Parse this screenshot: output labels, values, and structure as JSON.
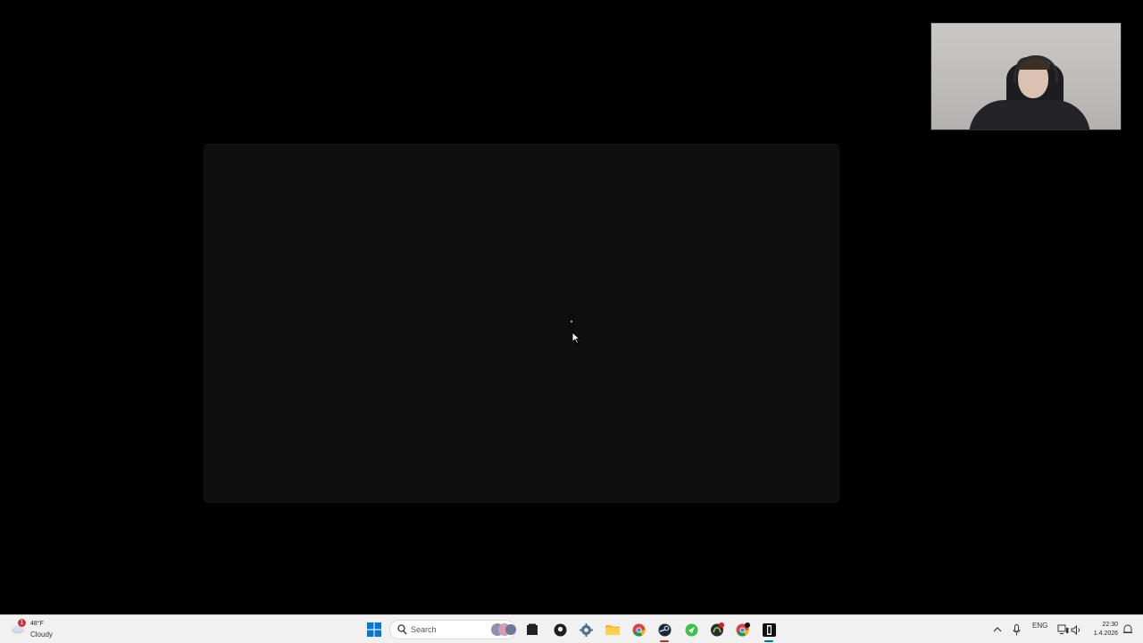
{
  "weather": {
    "badge": "1",
    "temp": "48°F",
    "condition": "Cloudy"
  },
  "taskbar": {
    "search_label": "Search",
    "language": "ENG"
  },
  "clock": {
    "time": "22:30",
    "date": "1.4.2026"
  },
  "colors": {
    "accent": "#0067c0",
    "taskbar_bg": "#f1f1f1",
    "app_window_bg": "#0f0f0f"
  },
  "icons": [
    "windows-start-icon",
    "search-icon",
    "task-view-icon",
    "app-icon",
    "settings-icon",
    "file-explorer-icon",
    "chrome-icon",
    "steam-icon",
    "app-icon",
    "app-icon",
    "chrome-icon",
    "app-icon",
    "chevron-up-icon",
    "microphone-icon",
    "network-icon",
    "volume-icon",
    "notification-icon"
  ]
}
